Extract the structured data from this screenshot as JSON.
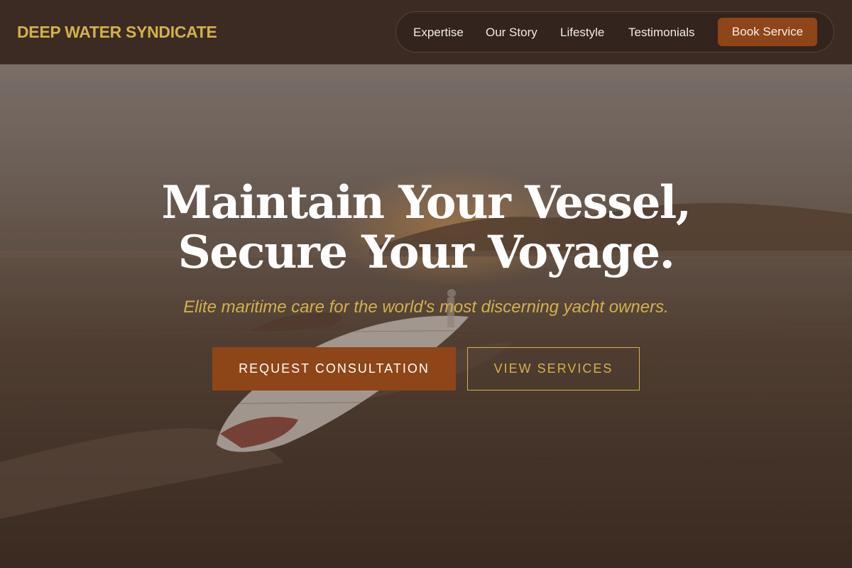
{
  "brand": {
    "name": "DEEP WATER SYNDICATE"
  },
  "nav": {
    "links": [
      {
        "label": "Expertise"
      },
      {
        "label": "Our Story"
      },
      {
        "label": "Lifestyle"
      },
      {
        "label": "Testimonials"
      }
    ],
    "cta_label": "Book Service"
  },
  "hero": {
    "title_line1": "Maintain Your Vessel,",
    "title_line2": "Secure Your Voyage.",
    "subtitle": "Elite maritime care for the world's most discerning yacht owners.",
    "primary_button": "REQUEST CONSULTATION",
    "secondary_button": "VIEW SERVICES",
    "background_image": "speedboat-at-sunset-photo"
  },
  "colors": {
    "accent_gold": "#d4b04a",
    "accent_rust": "#8e4517",
    "header_bg": "#3b2b23",
    "text_light": "#f1ebe6"
  }
}
